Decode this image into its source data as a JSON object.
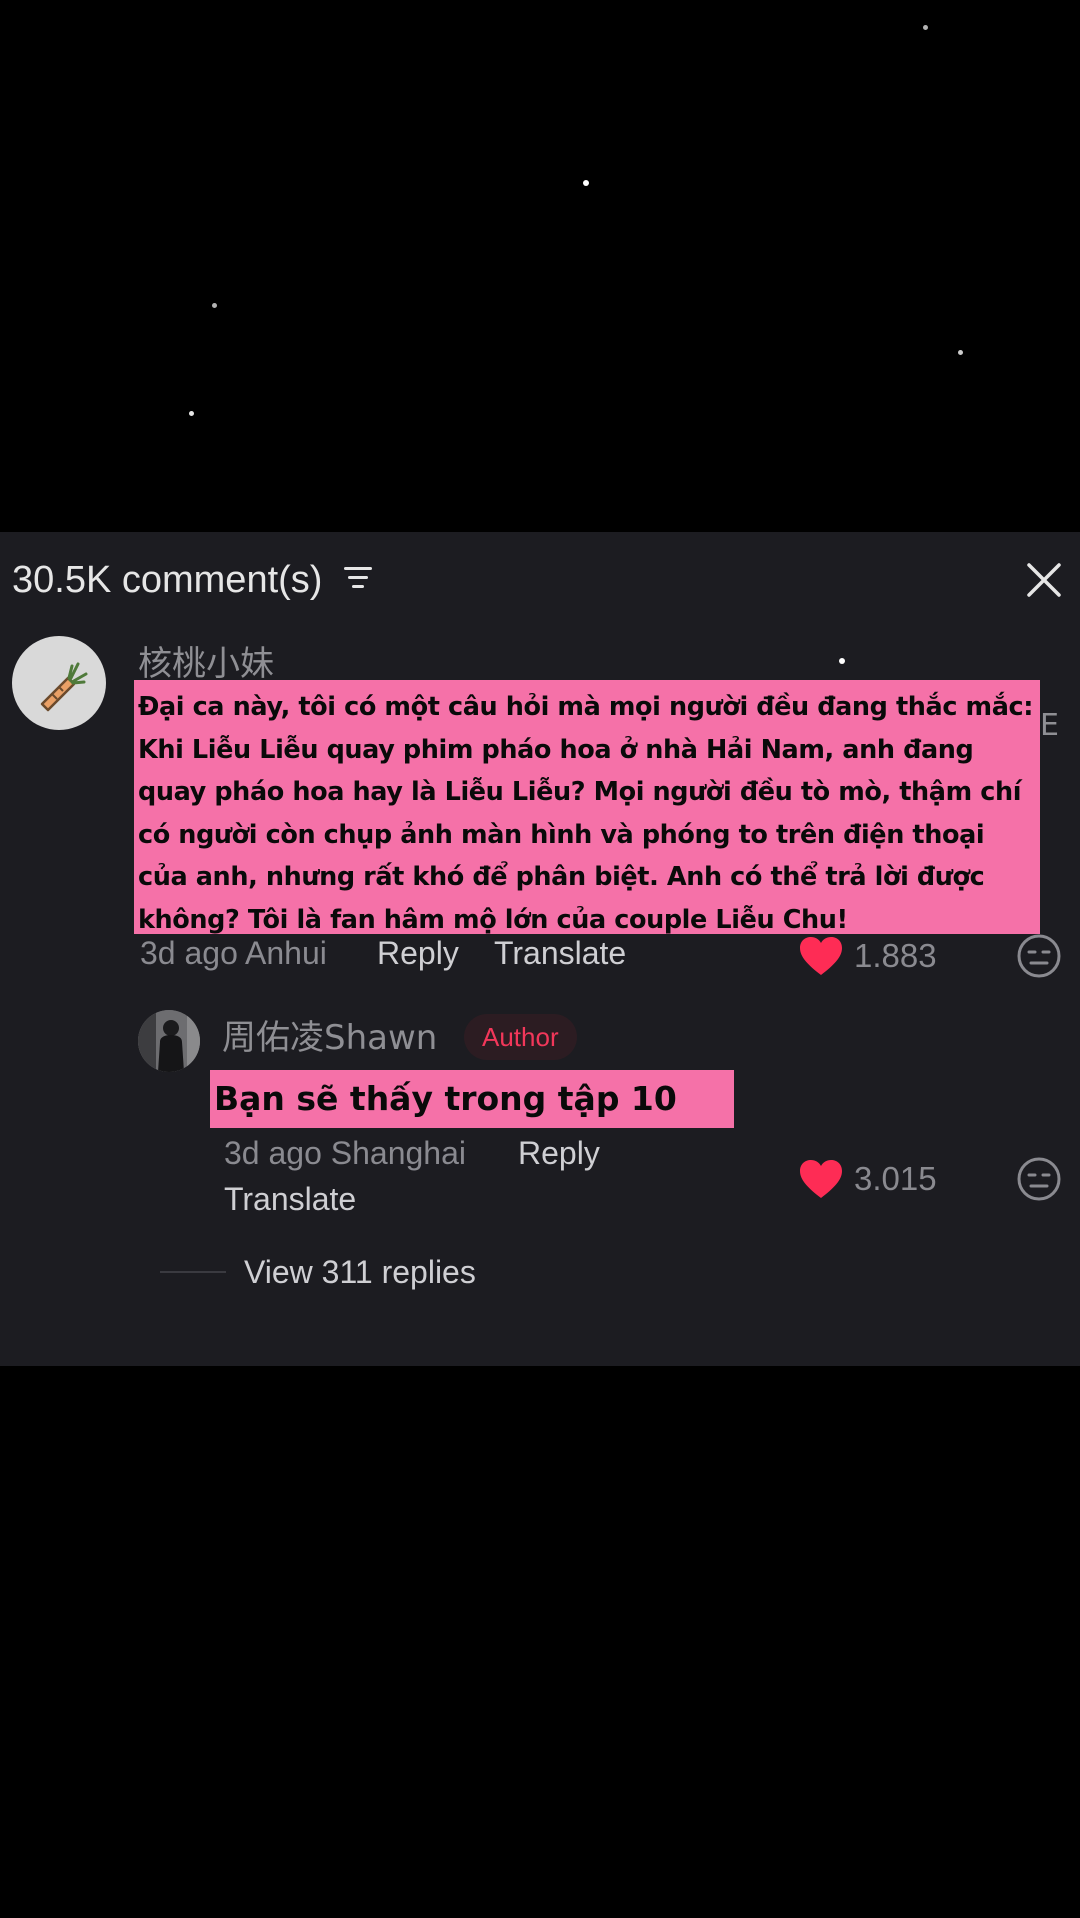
{
  "header": {
    "comment_count": "30.5K comment(s)",
    "filter_icon": "filter-icon",
    "close_icon": "close-icon"
  },
  "comments": [
    {
      "username": "核桃小妹",
      "avatar_icon": "carrot-icon",
      "text": "Đại ca này, tôi có một câu hỏi mà mọi người đều đang thắc mắc: Khi Liễu Liễu quay phim pháo hoa ở nhà Hải Nam, anh đang quay pháo hoa hay là Liễu Liễu? Mọi người đều tò mò, thậm chí có người còn chụp ảnh màn hình và phóng to trên điện thoại của anh, nhưng rất khó để phân biệt. Anh có thể trả lời được không? Tôi là fan hâm mộ lớn của couple Liễu Chu!",
      "edge_text": "E",
      "time_location": "3d ago Anhui",
      "reply_label": "Reply",
      "translate_label": "Translate",
      "likes": "1.883"
    }
  ],
  "reply": {
    "username": "周佑凌Shawn",
    "badge": "Author",
    "text": "Bạn sẽ thấy trong tập 10",
    "time_location": "3d ago Shanghai",
    "reply_label": "Reply",
    "translate_label": "Translate",
    "likes": "3.015"
  },
  "view_replies": "View 311 replies",
  "colors": {
    "background": "#000000",
    "panel": "#1c1c21",
    "highlight": "#f571a8",
    "heart": "#fe2c55",
    "author_badge_text": "#f2375a"
  }
}
